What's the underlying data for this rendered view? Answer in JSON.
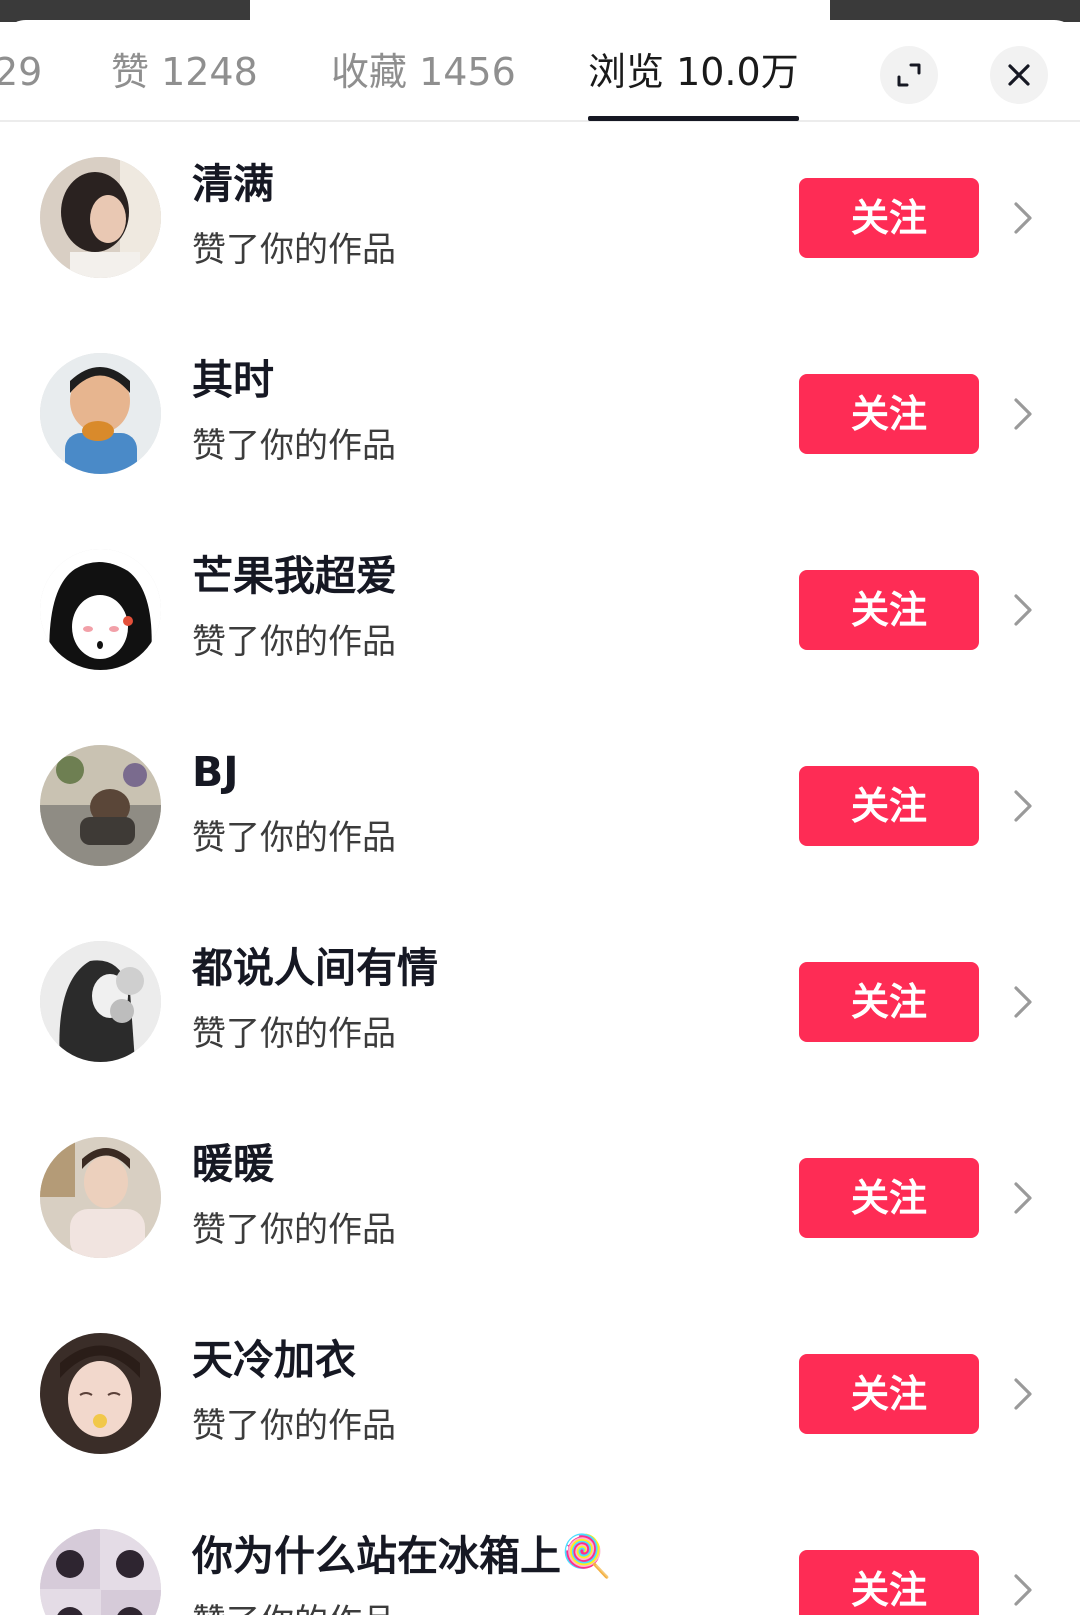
{
  "tabs": [
    {
      "label": "29"
    },
    {
      "label": "赞 1248"
    },
    {
      "label": "收藏 1456"
    },
    {
      "label": "浏览 10.0万"
    }
  ],
  "active_tab": "浏览 10.0万",
  "icons": {
    "expand": "expand-icon",
    "close": "close-icon",
    "chevron": "chevron-right-icon"
  },
  "colors": {
    "follow_button": "#fe2c55",
    "active_tab_underline": "#161823"
  },
  "list": [
    {
      "name": "清满",
      "action": "赞了你的作品",
      "button": "关注"
    },
    {
      "name": "其时",
      "action": "赞了你的作品",
      "button": "关注"
    },
    {
      "name": "芒果我超爱",
      "action": "赞了你的作品",
      "button": "关注"
    },
    {
      "name": "BJ",
      "action": "赞了你的作品",
      "button": "关注"
    },
    {
      "name": "都说人间有情",
      "action": "赞了你的作品",
      "button": "关注"
    },
    {
      "name": "暖暖",
      "action": "赞了你的作品",
      "button": "关注"
    },
    {
      "name": "天冷加衣",
      "action": "赞了你的作品",
      "button": "关注"
    },
    {
      "name": "你为什么站在冰箱上🍭",
      "action": "赞了你的作品",
      "button": "关注"
    }
  ]
}
